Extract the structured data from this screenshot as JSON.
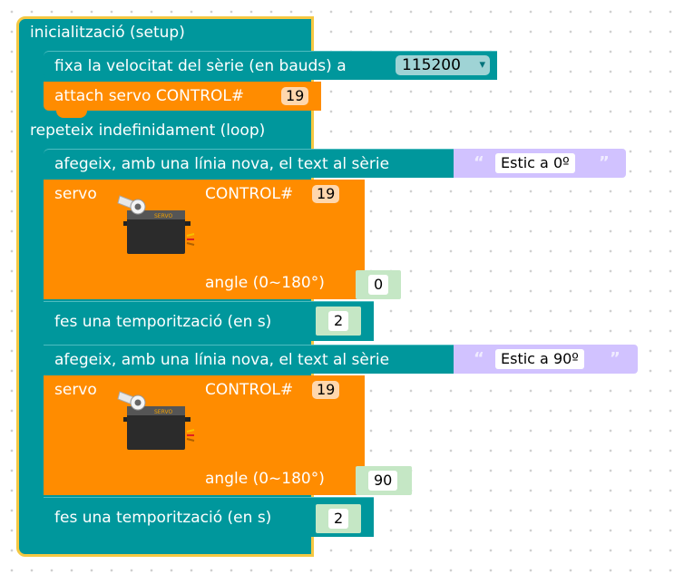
{
  "setup": {
    "header": "inicialització (setup)",
    "serial_label": "fixa la velocitat del sèrie (en bauds) a",
    "baud_value": "115200",
    "attach_label": "attach servo CONTROL#",
    "attach_pin": "19"
  },
  "loop": {
    "header": "repeteix indefinidament (loop)",
    "println1_label": "afegeix, amb una línia nova, el text al sèrie",
    "println1_text": "Estic a 0º",
    "servo1": {
      "label": "servo",
      "control_label": "CONTROL#",
      "pin": "19",
      "angle_label": "angle (0~180°)",
      "angle": "0",
      "icon_text": "SERVO"
    },
    "delay1_label": "fes una temporització (en s)",
    "delay1_value": "2",
    "println2_label": "afegeix, amb una línia nova, el text al sèrie",
    "println2_text": "Estic a 90º",
    "servo2": {
      "label": "servo",
      "control_label": "CONTROL#",
      "pin": "19",
      "angle_label": "angle (0~180°)",
      "angle": "90",
      "icon_text": "SERVO"
    },
    "delay2_label": "fes una temporització (en s)",
    "delay2_value": "2"
  },
  "quote_open": "“",
  "quote_close": "”",
  "dropdown_arrow": "▾",
  "colors": {
    "teal": "#00979c",
    "orange": "#ff8c00",
    "border": "#f5c842",
    "lavender": "#d1c2ff",
    "green": "#c5e7c5",
    "number_bg": "#ffd7ad"
  }
}
